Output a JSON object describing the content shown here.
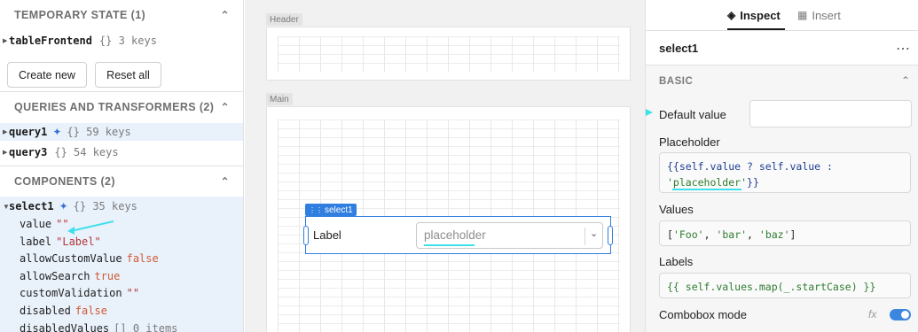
{
  "left": {
    "temp_state": {
      "title": "TEMPORARY STATE (1)",
      "item_name": "tableFrontend",
      "item_meta": "{}  3 keys"
    },
    "buttons": {
      "create": "Create new",
      "reset": "Reset all"
    },
    "queries": {
      "title": "QUERIES AND TRANSFORMERS (2)",
      "items": [
        {
          "name": "query1",
          "meta": "{}  59 keys"
        },
        {
          "name": "query3",
          "meta": "{}  54 keys"
        }
      ]
    },
    "components": {
      "title": "COMPONENTS (2)",
      "item_name": "select1",
      "item_meta": "{}  35 keys",
      "props": [
        {
          "key": "value",
          "val": "\"\"",
          "type": "str"
        },
        {
          "key": "label",
          "val": "\"Label\"",
          "type": "str"
        },
        {
          "key": "allowCustomValue",
          "val": "false",
          "type": "bool"
        },
        {
          "key": "allowSearch",
          "val": "true",
          "type": "bool"
        },
        {
          "key": "customValidation",
          "val": "\"\"",
          "type": "str"
        },
        {
          "key": "disabled",
          "val": "false",
          "type": "bool"
        },
        {
          "key": "disabledValues",
          "val": "[]  0 items",
          "type": "meta"
        }
      ]
    }
  },
  "canvas": {
    "header_label": "Header",
    "main_label": "Main",
    "component_tag": "select1",
    "select_label": "Label",
    "select_placeholder": "placeholder"
  },
  "inspector": {
    "tabs": [
      {
        "label": "Inspect"
      },
      {
        "label": "Insert"
      }
    ],
    "component_name": "select1",
    "more_glyph": "⋯",
    "section": "BASIC",
    "default_value_label": "Default value",
    "default_value": "",
    "placeholder_label": "Placeholder",
    "placeholder_code": {
      "open": "{{",
      "expr": "self.value ? self.value :",
      "str": "'placeholder'",
      "close": "}}"
    },
    "values_label": "Values",
    "values_code": {
      "ob": "[",
      "s1": "'Foo'",
      "s2": "'bar'",
      "s3": "'baz'",
      "cb": "]"
    },
    "labels_label": "Labels",
    "labels_code": "{{ self.values.map(_.startCase) }}",
    "combobox_label": "Combobox mode",
    "combobox_on": true,
    "fx_glyph": "fx"
  },
  "colors": {
    "annotation": "#3fe0ec",
    "accent": "#2f7ee0"
  }
}
